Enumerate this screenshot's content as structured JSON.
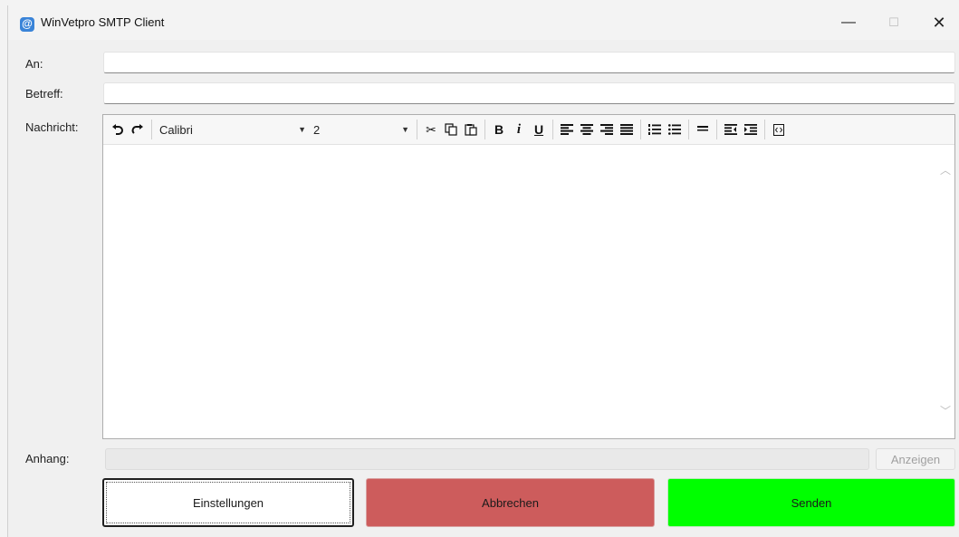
{
  "window": {
    "title": "WinVetpro SMTP Client",
    "icon": "at-sign-app-icon",
    "controls": {
      "minimize": "—",
      "maximize": "☐",
      "close": "✕"
    }
  },
  "form": {
    "to_label": "An:",
    "to_value": "",
    "subject_label": "Betreff:",
    "subject_value": "",
    "message_label": "Nachricht:",
    "attachment_label": "Anhang:",
    "attachment_value": ""
  },
  "toolbar": {
    "font": "Calibri",
    "size": "2",
    "bold": "B",
    "italic": "i",
    "underline": "U"
  },
  "buttons": {
    "show": "Anzeigen",
    "settings": "Einstellungen",
    "cancel": "Abbrechen",
    "send": "Senden"
  },
  "colors": {
    "cancel": "#cd5c5c",
    "send": "#00ff00",
    "app_icon": "#3a84d8"
  }
}
